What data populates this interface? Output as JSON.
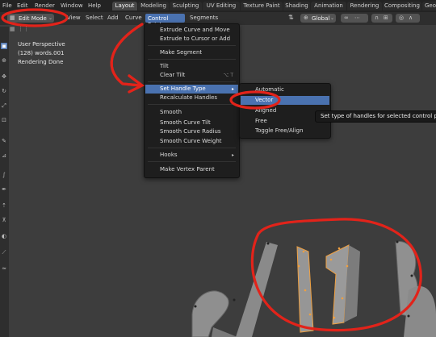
{
  "menus": [
    "File",
    "Edit",
    "Render",
    "Window",
    "Help"
  ],
  "workspaces": [
    "Layout",
    "Modeling",
    "Sculpting",
    "UV Editing",
    "Texture Paint",
    "Shading",
    "Animation",
    "Rendering",
    "Compositing",
    "Geo"
  ],
  "header": {
    "mode": "Edit Mode",
    "items": [
      "View",
      "Select",
      "Add",
      "Curve"
    ],
    "control_points": "Control Points",
    "segments": "Segments",
    "orientation": "Global"
  },
  "viewport_info": {
    "perspective": "User Perspective",
    "object": "(128) words.001",
    "status": "Rendering Done"
  },
  "control_points_menu": {
    "items": [
      "Extrude Curve and Move",
      "Extrude to Cursor or Add",
      "Make Segment",
      "Tilt",
      "Clear Tilt",
      "Set Handle Type",
      "Recalculate Handles",
      "Smooth",
      "Smooth Curve Tilt",
      "Smooth Curve Radius",
      "Smooth Curve Weight",
      "Hooks",
      "Make Vertex Parent"
    ],
    "clear_tilt_shortcut": "⌥ T"
  },
  "handle_type_menu": {
    "items": [
      "Automatic",
      "Vector",
      "Aligned",
      "Free",
      "Toggle Free/Align"
    ]
  },
  "tooltip": "Set type of handles for selected control points",
  "colors": {
    "annotation": "#e2231a",
    "highlight": "#4a72b0",
    "mesh": "#8f8f8f"
  },
  "scene_glyphs": [
    "2",
    "/",
    "1",
    "6"
  ]
}
